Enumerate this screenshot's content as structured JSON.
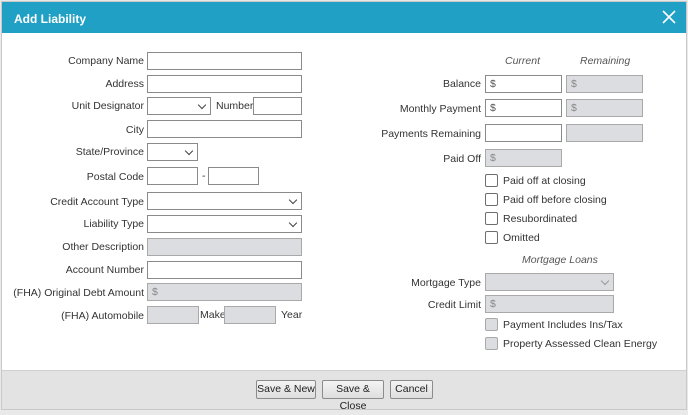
{
  "dialog": {
    "title": "Add Liability",
    "close_icon": "close-x-icon"
  },
  "left": {
    "company_name": "Company Name",
    "address": "Address",
    "unit_designator": "Unit Designator",
    "number": "Number",
    "city": "City",
    "state_province": "State/Province",
    "postal_code": "Postal Code",
    "postal_dash": "-",
    "credit_account_type": "Credit Account Type",
    "liability_type": "Liability Type",
    "other_description": "Other Description",
    "account_number": "Account Number",
    "fha_original_debt_amount": "(FHA) Original Debt Amount",
    "fha_automobile": "(FHA) Automobile",
    "make": "Make",
    "year": "Year",
    "currency_prefix": "$"
  },
  "right": {
    "current_header": "Current",
    "remaining_header": "Remaining",
    "balance": "Balance",
    "monthly_payment": "Monthly Payment",
    "payments_remaining": "Payments Remaining",
    "paid_off": "Paid Off",
    "currency_prefix": "$",
    "checkboxes": [
      "Paid off at closing",
      "Paid off before closing",
      "Resubordinated",
      "Omitted"
    ],
    "mortgage_loans_header": "Mortgage Loans",
    "mortgage_type": "Mortgage Type",
    "credit_limit": "Credit Limit",
    "mortgage_checkboxes": [
      "Payment Includes Ins/Tax",
      "Property Assessed Clean Energy"
    ]
  },
  "footer": {
    "save_new": "Save & New",
    "save_close": "Save & Close",
    "cancel": "Cancel"
  },
  "colors": {
    "titlebar": "#1fa0c4",
    "disabled_field": "#dcdde1"
  }
}
